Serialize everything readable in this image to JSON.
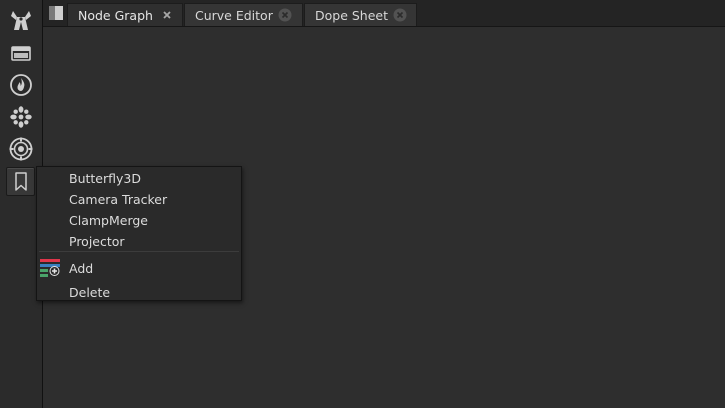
{
  "toolbar": {
    "tools": [
      {
        "icon": "toolbox-icon"
      },
      {
        "icon": "image-icon"
      },
      {
        "icon": "particles-icon"
      },
      {
        "icon": "flower-icon"
      },
      {
        "icon": "3d-target-icon"
      },
      {
        "icon": "bookmark-icon",
        "active": true
      }
    ]
  },
  "tabs": [
    {
      "label": "Node Graph",
      "active": true
    },
    {
      "label": "Curve Editor",
      "active": false
    },
    {
      "label": "Dope Sheet",
      "active": false
    }
  ],
  "context_menu": {
    "items": [
      {
        "label": "Butterfly3D"
      },
      {
        "label": "Camera Tracker"
      },
      {
        "label": "ClampMerge"
      },
      {
        "label": "Projector"
      }
    ],
    "actions": [
      {
        "label": "Add",
        "icon": "add-bookmark-icon"
      },
      {
        "label": "Delete"
      }
    ]
  },
  "colors": {
    "background": "#2b2b2b",
    "tabbar": "#242424",
    "text": "#dcdcdc",
    "add_icon_red": "#e0364b",
    "add_icon_blue": "#3a7fbf",
    "add_icon_green": "#4aa36a"
  }
}
